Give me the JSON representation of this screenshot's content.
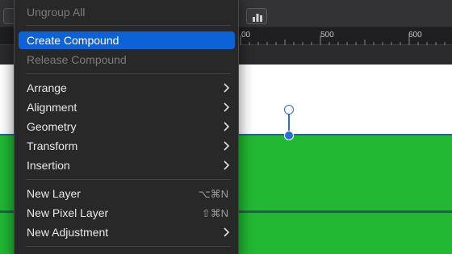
{
  "menu": {
    "ungroup_all": "Ungroup All",
    "create_compound": "Create Compound",
    "release_compound": "Release Compound",
    "arrange": "Arrange",
    "alignment": "Alignment",
    "geometry": "Geometry",
    "transform": "Transform",
    "insertion": "Insertion",
    "new_layer": "New Layer",
    "new_layer_shortcut": "⌥⌘N",
    "new_pixel_layer": "New Pixel Layer",
    "new_pixel_layer_shortcut": "⇧⌘N",
    "new_adjustment": "New Adjustment"
  },
  "ruler": {
    "label_400": "00",
    "label_500": "500",
    "label_600": "600"
  },
  "colors": {
    "selection": "#0d62d8",
    "canvas_green": "#22b833",
    "handle_blue": "#2c6bd6"
  },
  "icons": {
    "submenu": "chevron-right-icon",
    "toolbar_chart": "bar-chart-icon"
  }
}
